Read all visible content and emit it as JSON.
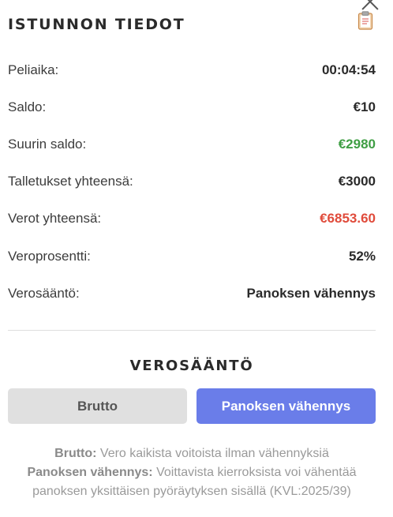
{
  "header": {
    "title": "ISTUNNON TIEDOT",
    "close_icon": "close-icon",
    "clipboard_icon": "clipboard-icon"
  },
  "stats": [
    {
      "label": "Peliaika:",
      "value": "00:04:54"
    },
    {
      "label": "Saldo:",
      "value": "€10"
    },
    {
      "label": "Suurin saldo:",
      "value": "€2980",
      "color": "#3f9e44"
    },
    {
      "label": "Talletukset yhteensä:",
      "value": "€3000"
    },
    {
      "label": "Verot yhteensä:",
      "value": "€6853.60",
      "color": "#e04b3b"
    },
    {
      "label": "Veroprosentti:",
      "value": "52%"
    },
    {
      "label": "Verosääntö:",
      "value": "Panoksen vähennys"
    }
  ],
  "tax_rule": {
    "title": "VEROSÄÄNTÖ",
    "options": [
      {
        "label": "Brutto",
        "selected": false
      },
      {
        "label": "Panoksen vähennys",
        "selected": true
      }
    ],
    "accent_color": "#6a7de9",
    "descriptions": [
      {
        "term": "Brutto:",
        "text": " Vero kaikista voitoista ilman vähennyksiä"
      },
      {
        "term": "Panoksen vähennys:",
        "text": " Voittavista kierroksista voi vähentää panoksen yksittäisen pyöräytyksen sisällä (KVL:2025/39)"
      }
    ]
  }
}
